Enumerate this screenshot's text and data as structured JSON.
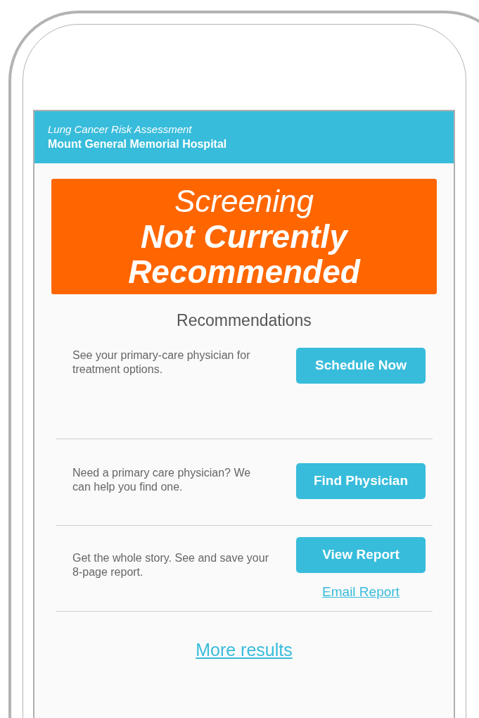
{
  "header": {
    "subtitle": "Lung Cancer Risk Assessment",
    "title": "Mount General Memorial Hospital"
  },
  "banner": {
    "line1": "Screening",
    "line2": "Not Currently Recommended"
  },
  "section_title": "Recommendations",
  "recommendations": [
    {
      "text": "See your primary-care physician for treatment options.",
      "button": "Schedule Now"
    },
    {
      "text": "Need a primary care physician? We can help you find one.",
      "button": "Find Physician"
    },
    {
      "text": "Get the whole story. See and save your 8-page report.",
      "button": "View Report",
      "link": "Email Report"
    }
  ],
  "more_link": "More results"
}
